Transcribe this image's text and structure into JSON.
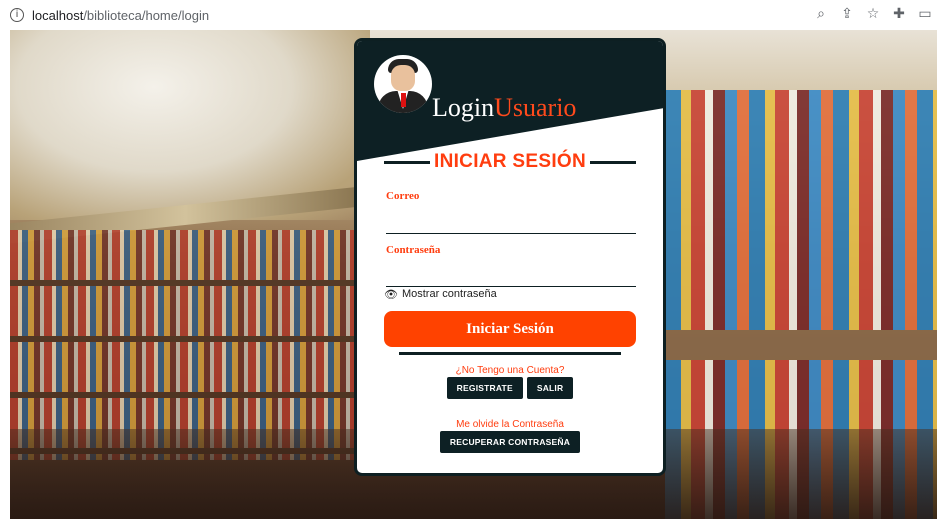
{
  "browser": {
    "url_host": "localhost",
    "url_path": "/biblioteca/home/login",
    "toolbar_icons": [
      "zoom-icon",
      "share-icon",
      "star-icon",
      "extensions-icon",
      "sidepanel-icon"
    ]
  },
  "login": {
    "brand_part1": "Login",
    "brand_part2": "Usuario",
    "heading": "INICIAR SESIÓN",
    "user_label": "Correo",
    "user_value": "",
    "pass_label": "Contraseña",
    "pass_value": "",
    "show_password": "Mostrar contraseña",
    "submit": "Iniciar Sesión",
    "no_account": "¿No Tengo una Cuenta?",
    "register": "REGISTRATE",
    "exit": "SALIR",
    "forgot": "Me olvide la Contraseña",
    "recover": "RECUPERAR CONTRASEÑA"
  },
  "colors": {
    "accent": "#ff4200",
    "dark": "#0d2024"
  }
}
